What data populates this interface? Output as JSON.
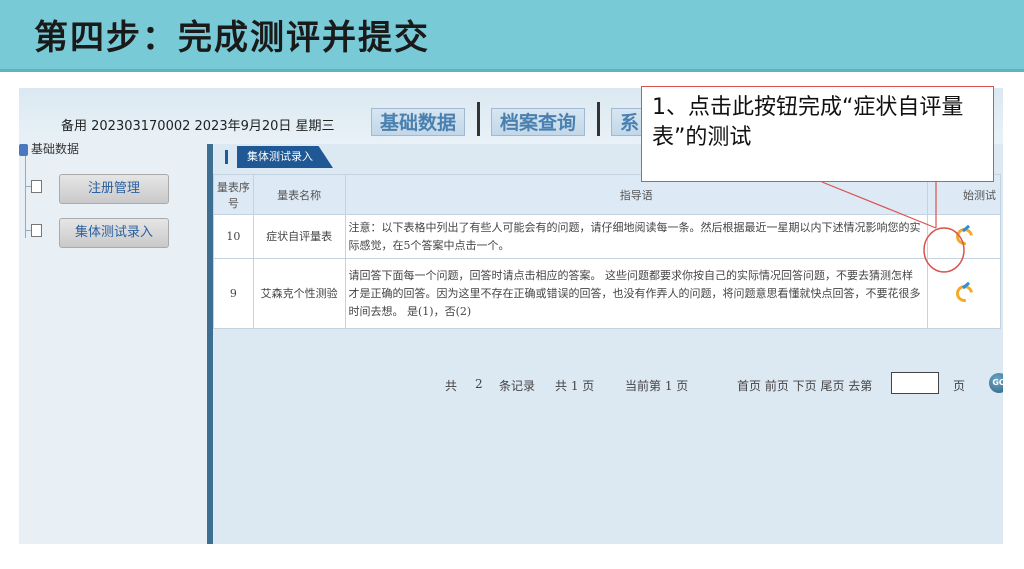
{
  "slide": {
    "title": "第四步：完成测评并提交"
  },
  "app": {
    "user_info": "备用 202303170002 2023年9月20日 星期三",
    "tabs": [
      "基础数据",
      "档案查询",
      "系"
    ]
  },
  "sidebar": {
    "root_label": "基础数据",
    "items": [
      {
        "label": "注册管理"
      },
      {
        "label": "集体测试录入"
      }
    ]
  },
  "main": {
    "section_tab": "集体测试录入",
    "table": {
      "headers": {
        "no": "量表序号",
        "name": "量表名称",
        "guide": "指导语",
        "start": "始测试"
      },
      "rows": [
        {
          "no": "10",
          "name": "症状自评量表",
          "guide": "注意：以下表格中列出了有些人可能会有的问题，请仔细地阅读每一条。然后根据最近一星期以内下述情况影响您的实际感觉，在5个答案中点击一个。"
        },
        {
          "no": "9",
          "name": "艾森克个性测验",
          "guide": "请回答下面每一个问题，回答时请点击相应的答案。 这些问题都要求你按自己的实际情况回答问题，不要去猜测怎样才是正确的回答。因为这里不存在正确或错误的回答，也没有作弄人的问题，将问题意思看懂就快点回答，不要花很多时间去想。 是(1)，否(2)"
        }
      ]
    },
    "pager": {
      "total_prefix": "共",
      "total_records": "2",
      "records_label": "条记录",
      "pages_text": "共 1 页",
      "current_text": "当前第 1 页",
      "nav_text": "首页 前页 下页 尾页 去第",
      "page_suffix": "页",
      "go_label": "GO"
    }
  },
  "callout": {
    "text": "1、点击此按钮完成“症状自评量表”的测试",
    "color": "#d9534f"
  },
  "colors": {
    "title_bar": "#78cad6",
    "nav_dark": "#1f5894",
    "tab_text": "#4a80b0"
  }
}
